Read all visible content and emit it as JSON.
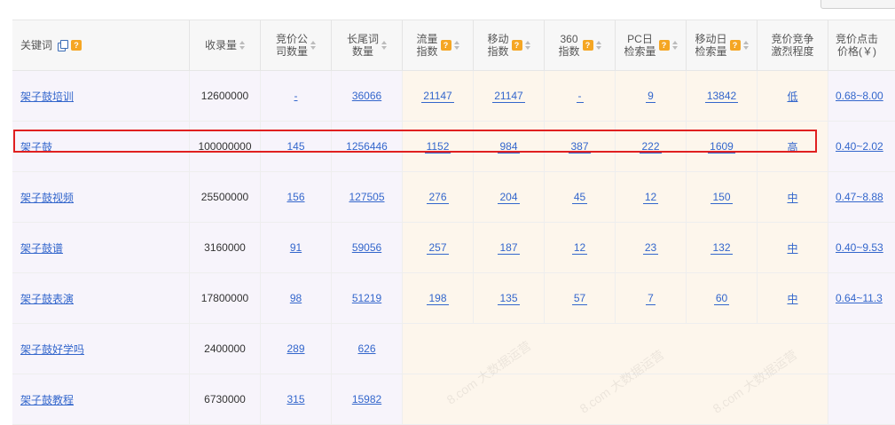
{
  "columns": [
    {
      "label": [
        "关键词"
      ],
      "copy": true,
      "help": true,
      "sort": false
    },
    {
      "label": [
        "收录量"
      ],
      "sort": true
    },
    {
      "label": [
        "竞价公",
        "司数量"
      ],
      "sort": true
    },
    {
      "label": [
        "长尾词",
        "数量"
      ],
      "sort": true
    },
    {
      "label": [
        "流量",
        "指数"
      ],
      "help": true,
      "sort": true
    },
    {
      "label": [
        "移动",
        "指数"
      ],
      "help": true,
      "sort": true
    },
    {
      "label": [
        "360",
        "指数"
      ],
      "help": true,
      "sort": true
    },
    {
      "label": [
        "PC日",
        "检索量"
      ],
      "help": true,
      "sort": true
    },
    {
      "label": [
        "移动日",
        "检索量"
      ],
      "help": true,
      "sort": true
    },
    {
      "label": [
        "竞价竞争",
        "激烈程度"
      ],
      "sort": false
    },
    {
      "label": [
        "竞价点击",
        "价格(￥)"
      ],
      "sort": false
    }
  ],
  "rows": [
    {
      "keyword": "架子鼓培训",
      "indexed": "12600000",
      "bid_companies": "-",
      "longtail": "36066",
      "traffic": "21147",
      "mobile": "21147",
      "i360": "-",
      "pc_daily": "9",
      "mobile_daily": "13842",
      "competition": "低",
      "price": "0.68~8.00"
    },
    {
      "keyword": "架子鼓",
      "indexed": "100000000",
      "bid_companies": "145",
      "longtail": "1256446",
      "traffic": "1152",
      "mobile": "984",
      "i360": "387",
      "pc_daily": "222",
      "mobile_daily": "1609",
      "competition": "高",
      "price": "0.40~2.02"
    },
    {
      "keyword": "架子鼓视频",
      "indexed": "25500000",
      "bid_companies": "156",
      "longtail": "127505",
      "traffic": "276",
      "mobile": "204",
      "i360": "45",
      "pc_daily": "12",
      "mobile_daily": "150",
      "competition": "中",
      "price": "0.47~8.88"
    },
    {
      "keyword": "架子鼓谱",
      "indexed": "3160000",
      "bid_companies": "91",
      "longtail": "59056",
      "traffic": "257",
      "mobile": "187",
      "i360": "12",
      "pc_daily": "23",
      "mobile_daily": "132",
      "competition": "中",
      "price": "0.40~9.53"
    },
    {
      "keyword": "架子鼓表演",
      "indexed": "17800000",
      "bid_companies": "98",
      "longtail": "51219",
      "traffic": "198",
      "mobile": "135",
      "i360": "57",
      "pc_daily": "7",
      "mobile_daily": "60",
      "competition": "中",
      "price": "0.64~11.3"
    },
    {
      "keyword": "架子鼓好学吗",
      "indexed": "2400000",
      "bid_companies": "289",
      "longtail": "626",
      "traffic": "",
      "mobile": "",
      "i360": "",
      "pc_daily": "",
      "mobile_daily": "",
      "competition": "",
      "price": ""
    },
    {
      "keyword": "架子鼓教程",
      "indexed": "6730000",
      "bid_companies": "315",
      "longtail": "15982",
      "traffic": "",
      "mobile": "",
      "i360": "",
      "pc_daily": "",
      "mobile_daily": "",
      "competition": "",
      "price": ""
    }
  ],
  "watermark": "8.com 大数据运营",
  "help_glyph": "?",
  "colors": {
    "link": "#3366cc",
    "highlight": "#e02020",
    "help": "#f5a623",
    "left_bg": "#f7f4fb",
    "right_bg": "#fdf6ec"
  }
}
